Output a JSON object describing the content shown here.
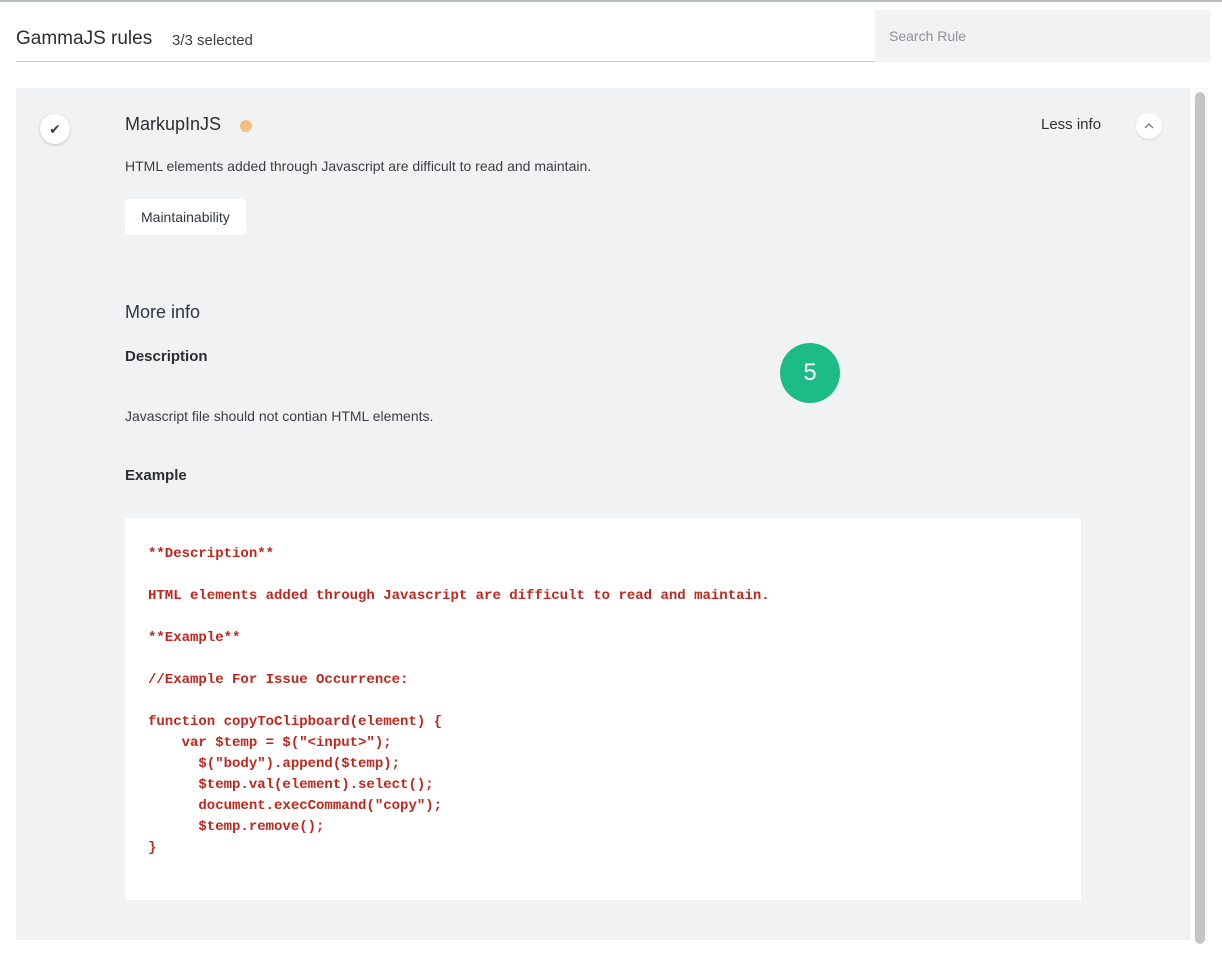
{
  "header": {
    "title": "GammaJS rules",
    "selected_count": "3/3 selected",
    "search_placeholder": "Search Rule"
  },
  "rule": {
    "checked_icon": "check-icon",
    "name": "MarkupInJS",
    "severity_color": "#f3bf7e",
    "toggle_label": "Less info",
    "toggle_icon": "chevron-up-icon",
    "summary": "HTML elements added through Javascript are difficult to read and maintain.",
    "tag": "Maintainability",
    "more_info_title": "More info",
    "description_heading": "Description",
    "description_text": "Javascript file should not contian HTML elements.",
    "example_heading": "Example",
    "code": "**Description**\n\nHTML elements added through Javascript are difficult to read and maintain.\n\n**Example**\n\n//Example For Issue Occurrence:\n\nfunction copyToClipboard(element) {\n    var $temp = $(\"<input>\");\n      $(\"body\").append($temp);\n      $temp.val(element).select();\n      document.execCommand(\"copy\");\n      $temp.remove();\n}"
  },
  "badge": {
    "number": "5",
    "color": "#1dbb85"
  }
}
